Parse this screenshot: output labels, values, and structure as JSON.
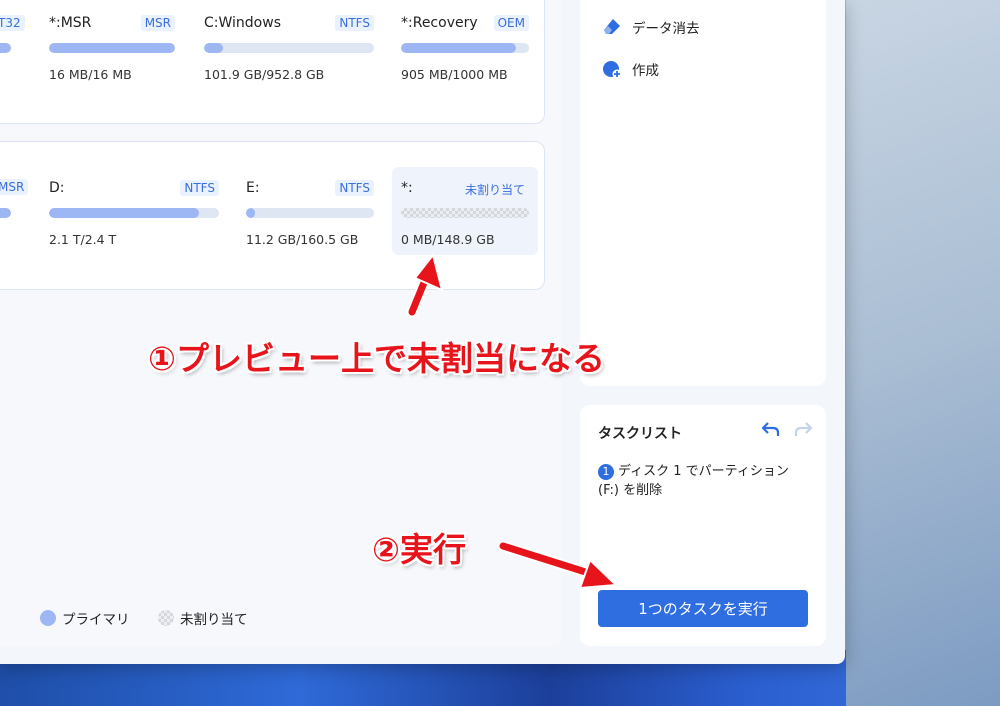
{
  "disk1": {
    "cut_fs": "T32",
    "partitions": [
      {
        "name": "*:MSR",
        "fs": "MSR",
        "size": "16 MB/16 MB",
        "used_fraction": 1.0
      },
      {
        "name": "C:Windows",
        "fs": "NTFS",
        "size": "101.9 GB/952.8 GB",
        "used_fraction": 0.11
      },
      {
        "name": "*:Recovery",
        "fs": "OEM",
        "size": "905 MB/1000 MB",
        "used_fraction": 0.9
      }
    ]
  },
  "disk2": {
    "cut_fs": "MSR",
    "partitions": [
      {
        "name": "D:",
        "fs": "NTFS",
        "size": "2.1 T/2.4 T",
        "used_fraction": 0.88
      },
      {
        "name": "E:",
        "fs": "NTFS",
        "size": "11.2 GB/160.5 GB",
        "used_fraction": 0.07
      },
      {
        "name": "*:",
        "fs": "未割り当て",
        "size": "0 MB/148.9 GB",
        "used_fraction": 0
      }
    ]
  },
  "legend": {
    "primary": "プライマリ",
    "unallocated": "未割り当て"
  },
  "sidebar": {
    "items": [
      {
        "label": "データ消去",
        "icon": "eraser-icon"
      },
      {
        "label": "作成",
        "icon": "create-icon"
      }
    ]
  },
  "tasks": {
    "title": "タスクリスト",
    "entries": [
      {
        "number": "1",
        "text": "ディスク 1 でパーティション (F:) を削除"
      }
    ],
    "execute_label": "1つのタスクを実行"
  },
  "annotations": {
    "step1": "①プレビュー上で未割当になる",
    "step2": "②実行"
  },
  "colors": {
    "accent": "#2f6ee0",
    "bar_fill": "#9db7f4",
    "annotation": "#e8141c"
  }
}
